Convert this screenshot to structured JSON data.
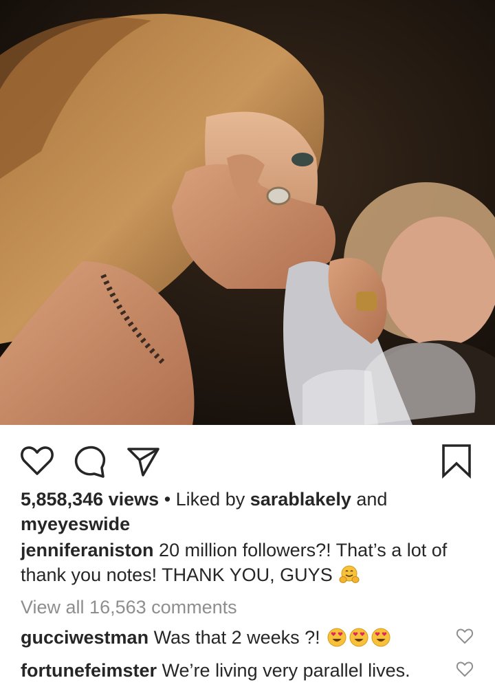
{
  "post": {
    "media_alt": "Video still: woman covering her face with her hand at an awards ceremony, another woman smiling in the background behind wine glasses",
    "views": "5,858,346 views",
    "separator": "•",
    "liked_by_prefix": "Liked by",
    "liked_by_user1": "sarablakely",
    "liked_by_and": "and",
    "liked_by_user2": "myeyeswide",
    "caption_user": "jenniferaniston",
    "caption_text_line1": "20 million followers?! That’s a lot of",
    "caption_text_line2": "thank you notes! THANK YOU, GUYS",
    "view_all_comments": "View all 16,563 comments"
  },
  "comments": [
    {
      "user": "gucciwestman",
      "text": "Was that 2 weeks ?!"
    },
    {
      "user": "fortunefeimster",
      "text": "We’re living very parallel lives."
    }
  ],
  "icons": {
    "like": "heart-icon",
    "comment": "comment-icon",
    "share": "send-icon",
    "save": "bookmark-icon",
    "hug_emoji": "hugging-face-emoji",
    "heart_eyes_emoji": "heart-eyes-emoji"
  },
  "colors": {
    "text": "#262626",
    "muted": "#8e8e8e",
    "emoji_yellow": "#f7c23a",
    "emoji_heart": "#e0245e"
  }
}
